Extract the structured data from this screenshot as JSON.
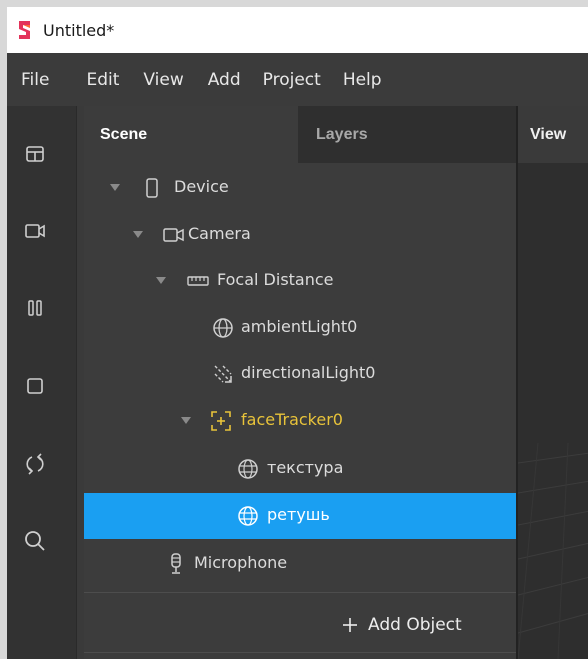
{
  "window": {
    "title": "Untitled*"
  },
  "menu": {
    "items": [
      "File",
      "Edit",
      "View",
      "Add",
      "Project",
      "Help"
    ]
  },
  "toolbar": {
    "tools": [
      "layout-icon",
      "camera-icon",
      "pause-icon",
      "square-icon",
      "sync-icon",
      "search-icon"
    ]
  },
  "scene_panel": {
    "tabs": {
      "scene": "Scene",
      "layers": "Layers"
    },
    "tree": [
      {
        "label": "Device",
        "icon": "device-icon",
        "expanded": true,
        "depth": 0
      },
      {
        "label": "Camera",
        "icon": "camera-icon",
        "expanded": true,
        "depth": 1
      },
      {
        "label": "Focal Distance",
        "icon": "ruler-icon",
        "expanded": true,
        "depth": 2
      },
      {
        "label": "ambientLight0",
        "icon": "globe-icon",
        "depth": 3
      },
      {
        "label": "directionalLight0",
        "icon": "directional-light-icon",
        "depth": 3
      },
      {
        "label": "faceTracker0",
        "icon": "face-tracker-icon",
        "expanded": true,
        "depth": 3,
        "color": "#e8c33a"
      },
      {
        "label": "текстура",
        "icon": "mesh-sphere-icon",
        "depth": 4
      },
      {
        "label": "ретушь",
        "icon": "mesh-sphere-icon",
        "depth": 4,
        "selected": true
      },
      {
        "label": "Microphone",
        "icon": "microphone-icon",
        "depth": 1
      }
    ],
    "add_object": "Add Object"
  },
  "viewport": {
    "tab": "View"
  },
  "colors": {
    "selection": "#1a9ff2",
    "tracker": "#e8c33a",
    "panel": "#3c3c3c"
  }
}
